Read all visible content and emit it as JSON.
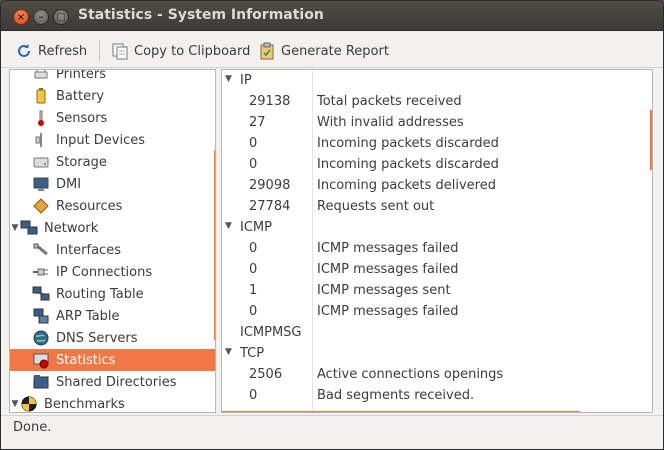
{
  "window": {
    "title": "Statistics - System Information",
    "close_glyph": "×",
    "min_glyph": "–",
    "max_glyph": "□"
  },
  "toolbar": {
    "refresh": "Refresh",
    "copy": "Copy to Clipboard",
    "report": "Generate Report"
  },
  "sidebar": {
    "items": [
      {
        "label": "Printers",
        "icon": "printer-icon",
        "level": 1
      },
      {
        "label": "Battery",
        "icon": "battery-icon",
        "level": 1
      },
      {
        "label": "Sensors",
        "icon": "thermometer-icon",
        "level": 1
      },
      {
        "label": "Input Devices",
        "icon": "keyboard-icon",
        "level": 1
      },
      {
        "label": "Storage",
        "icon": "hard-drive-icon",
        "level": 1
      },
      {
        "label": "DMI",
        "icon": "monitor-icon",
        "level": 1
      },
      {
        "label": "Resources",
        "icon": "resources-icon",
        "level": 1
      },
      {
        "label": "Network",
        "icon": "network-icon",
        "level": 0,
        "expanded": true
      },
      {
        "label": "Interfaces",
        "icon": "interfaces-icon",
        "level": 1
      },
      {
        "label": "IP Connections",
        "icon": "plug-icon",
        "level": 1
      },
      {
        "label": "Routing Table",
        "icon": "routing-icon",
        "level": 1
      },
      {
        "label": "ARP Table",
        "icon": "arp-icon",
        "level": 1
      },
      {
        "label": "DNS Servers",
        "icon": "globe-icon",
        "level": 1
      },
      {
        "label": "Statistics",
        "icon": "statistics-icon",
        "level": 1,
        "selected": true
      },
      {
        "label": "Shared Directories",
        "icon": "folder-share-icon",
        "level": 1
      },
      {
        "label": "Benchmarks",
        "icon": "benchmark-icon",
        "level": 0,
        "expanded": true
      }
    ]
  },
  "stats": {
    "rows": [
      {
        "type": "section",
        "name": "IP"
      },
      {
        "type": "item",
        "value": "29138",
        "label": "Total packets received"
      },
      {
        "type": "item",
        "value": "27",
        "label": "With invalid addresses"
      },
      {
        "type": "item",
        "value": "0",
        "label": "Incoming packets discarded"
      },
      {
        "type": "item",
        "value": "0",
        "label": "Incoming packets discarded"
      },
      {
        "type": "item",
        "value": "29098",
        "label": "Incoming packets delivered"
      },
      {
        "type": "item",
        "value": "27784",
        "label": "Requests sent out"
      },
      {
        "type": "section",
        "name": "ICMP"
      },
      {
        "type": "item",
        "value": "0",
        "label": "ICMP messages failed"
      },
      {
        "type": "item",
        "value": "0",
        "label": "ICMP messages failed"
      },
      {
        "type": "item",
        "value": "1",
        "label": "ICMP messages sent"
      },
      {
        "type": "item",
        "value": "0",
        "label": "ICMP messages failed"
      },
      {
        "type": "plain",
        "name": "ICMPMSG"
      },
      {
        "type": "section",
        "name": "TCP"
      },
      {
        "type": "item",
        "value": "2506",
        "label": "Active connections openings"
      },
      {
        "type": "item",
        "value": "0",
        "label": "Bad segments received."
      }
    ]
  },
  "status": {
    "text": "Done."
  },
  "colors": {
    "accent": "#f07746",
    "titlebar": "#3c3b37"
  }
}
